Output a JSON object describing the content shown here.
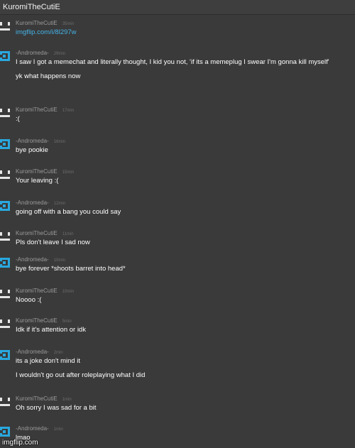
{
  "header": {
    "title": "KuromiTheCutiE"
  },
  "messages": [
    {
      "avatar": "kuromi-avatar-icon",
      "name": "KuromiTheCutiE",
      "time": "35min",
      "lines": [
        "imgflip.com/i/8l297w"
      ],
      "link": true
    },
    {
      "avatar": "andromeda-avatar-icon",
      "name": "-Andromeda-",
      "time": "29min",
      "lines": [
        "I saw I got a memechat and literally thought, I kid you not, 'if its a memeplug I swear I'm gonna kill myself'",
        "yk what happens now"
      ]
    },
    {
      "avatar": "kuromi-avatar-icon",
      "name": "KuromiTheCutiE",
      "time": "17min",
      "lines": [
        ":("
      ]
    },
    {
      "avatar": "andromeda-avatar-icon",
      "name": "-Andromeda-",
      "time": "16min",
      "lines": [
        "bye pookie"
      ]
    },
    {
      "avatar": "kuromi-avatar-icon",
      "name": "KuromiTheCutiE",
      "time": "15min",
      "lines": [
        "Your leaving :("
      ]
    },
    {
      "avatar": "andromeda-avatar-icon",
      "name": "-Andromeda-",
      "time": "12min",
      "lines": [
        "going off with a bang you could say"
      ]
    },
    {
      "avatar": "kuromi-avatar-icon",
      "name": "KuromiTheCutiE",
      "time": "11min",
      "lines": [
        "Pls don't leave I sad now"
      ]
    },
    {
      "avatar": "andromeda-avatar-icon",
      "name": "-Andromeda-",
      "time": "10min",
      "lines": [
        "bye forever *shoots barret into head*"
      ]
    },
    {
      "avatar": "kuromi-avatar-icon",
      "name": "KuromiTheCutiE",
      "time": "10min",
      "lines": [
        "Noooo :("
      ]
    },
    {
      "avatar": "kuromi-avatar-icon",
      "name": "KuromiTheCutiE",
      "time": "5min",
      "lines": [
        "Idk if it's attention or idk"
      ]
    },
    {
      "avatar": "andromeda-avatar-icon",
      "name": "-Andromeda-",
      "time": "2min",
      "lines": [
        "its a joke don't mind it",
        "I wouldn't go out after roleplaying what I did"
      ]
    },
    {
      "avatar": "kuromi-avatar-icon",
      "name": "KuromiTheCutiE",
      "time": "1min",
      "lines": [
        "Oh sorry I was sad for a bit"
      ]
    },
    {
      "avatar": "andromeda-avatar-icon",
      "name": "-Andromeda-",
      "time": "1min",
      "lines": [
        "lmao"
      ]
    }
  ],
  "footer": {
    "watermark": "imgflip.com"
  },
  "colors": {
    "background": "#3a3a3a",
    "link": "#45b2e6",
    "andromeda_avatar": "#29a8df",
    "kuromi_avatar": "#e6e6e6",
    "name": "#9a9a9a",
    "time": "#6d6d6d"
  }
}
